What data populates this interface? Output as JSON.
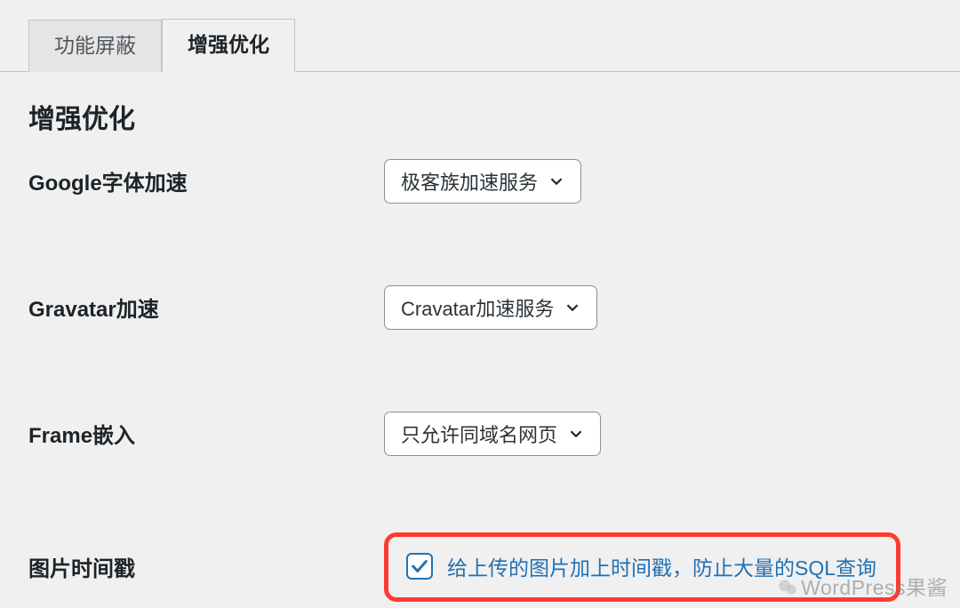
{
  "tabs": [
    {
      "label": "功能屏蔽",
      "active": false
    },
    {
      "label": "增强优化",
      "active": true
    }
  ],
  "section_title": "增强优化",
  "rows": {
    "google_fonts": {
      "label": "Google字体加速",
      "selected": "极客族加速服务"
    },
    "gravatar": {
      "label": "Gravatar加速",
      "selected": "Cravatar加速服务"
    },
    "frame_embed": {
      "label": "Frame嵌入",
      "selected": "只允许同域名网页"
    },
    "image_timestamp": {
      "label": "图片时间戳",
      "checkbox_label": "给上传的图片加上时间戳，防止大量的SQL查询",
      "checked": true
    }
  },
  "watermark": "WordPress果酱"
}
